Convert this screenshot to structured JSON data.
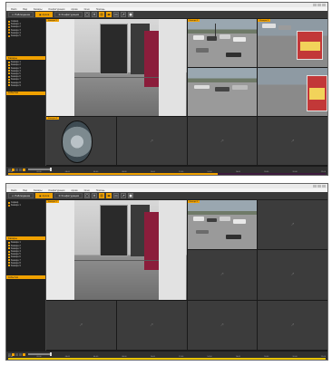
{
  "window1": {
    "toolbar": {
      "btn1": "Наблюдение",
      "btn2": "Архив",
      "btn3": "Конфигурация"
    },
    "sidebar": {
      "section_top": "",
      "tree_top": [
        "Сервер",
        "Камера 1",
        "Камера 2",
        "Камера 3",
        "Камера 4",
        "Камера 5"
      ],
      "section_mid": "Камеры",
      "tree_mid": [
        "Камера 1",
        "Камера 2",
        "Камера 3",
        "Камера 4",
        "Камера 5",
        "Камера 6",
        "Камера 7",
        "Камера 8",
        "Камера 9"
      ],
      "section_bottom": "События"
    },
    "cells": {
      "c1": "Камера 1",
      "c3": "Камера 2",
      "c4": "Камера 3",
      "c7": "Камера 4",
      "c8": "Камера 5",
      "c9": "Камера 6"
    }
  },
  "window2": {
    "toolbar": {
      "btn1": "Наблюдение",
      "btn2": "Архив",
      "btn3": "Конфигурация"
    },
    "sidebar": {
      "section_top": "",
      "tree_top": [
        "Сервер",
        "Камера 1"
      ],
      "section_mid": "Камеры",
      "tree_mid": [
        "Камера 1",
        "Камера 2",
        "Камера 3",
        "Камера 4",
        "Камера 5",
        "Камера 6",
        "Камера 7",
        "Камера 8",
        "Камера 9"
      ],
      "section_bottom": "События"
    },
    "cells": {
      "c1": "Камера 1",
      "c3": "Камера 2"
    }
  },
  "menu": [
    "Файл",
    "Вид",
    "Камеры",
    "Конфигурация",
    "Архив",
    "Окно",
    "Помощь"
  ],
  "timeline_scale": [
    "00:00",
    "02:00",
    "04:00",
    "06:00",
    "08:00",
    "10:00",
    "12:00",
    "14:00",
    "16:00",
    "18:00",
    "20:00",
    "22:00"
  ],
  "colors": {
    "accent": "#f0a100",
    "panel": "#2b2b2b"
  }
}
